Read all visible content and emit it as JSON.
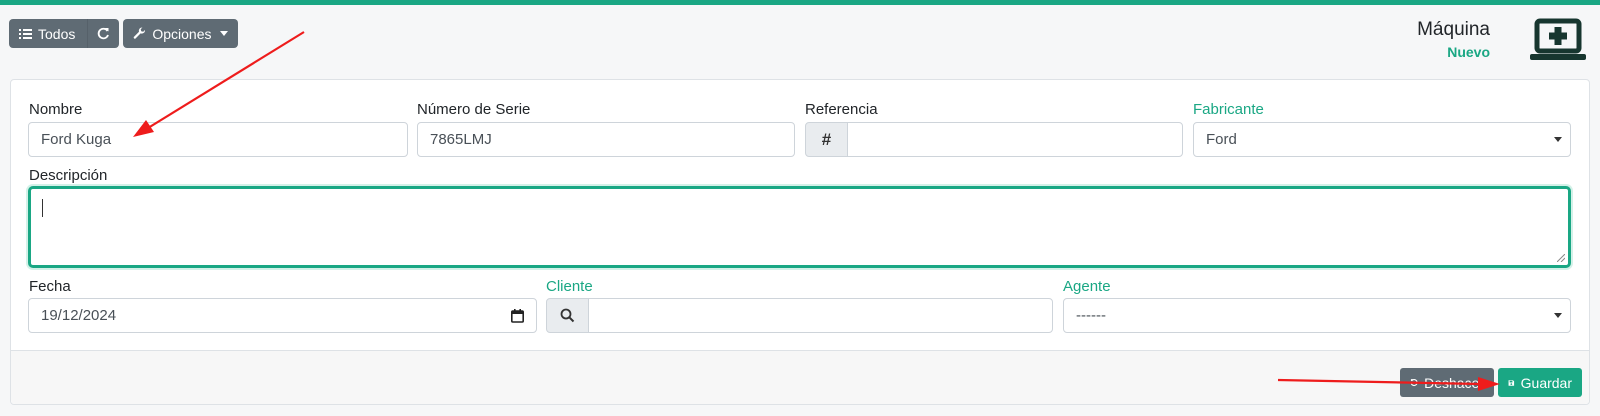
{
  "toolbar": {
    "all_label": "Todos",
    "options_label": "Opciones"
  },
  "header": {
    "title": "Máquina",
    "subtitle": "Nuevo"
  },
  "form": {
    "nombre_label": "Nombre",
    "nombre_value": "Ford Kuga",
    "serie_label": "Número de Serie",
    "serie_value": "7865LMJ",
    "referencia_label": "Referencia",
    "referencia_addon": "#",
    "referencia_value": "",
    "fabricante_label": "Fabricante",
    "fabricante_value": "Ford",
    "descripcion_label": "Descripción",
    "descripcion_value": "",
    "fecha_label": "Fecha",
    "fecha_value": "19/12/2024",
    "cliente_label": "Cliente",
    "cliente_value": "",
    "agente_label": "Agente",
    "agente_value": "------"
  },
  "footer": {
    "undo_label": "Deshacer",
    "save_label": "Guardar"
  },
  "colors": {
    "accent": "#1aa784",
    "button_grey": "#5f6b74",
    "annotation_arrow": "#ee1c1c"
  }
}
